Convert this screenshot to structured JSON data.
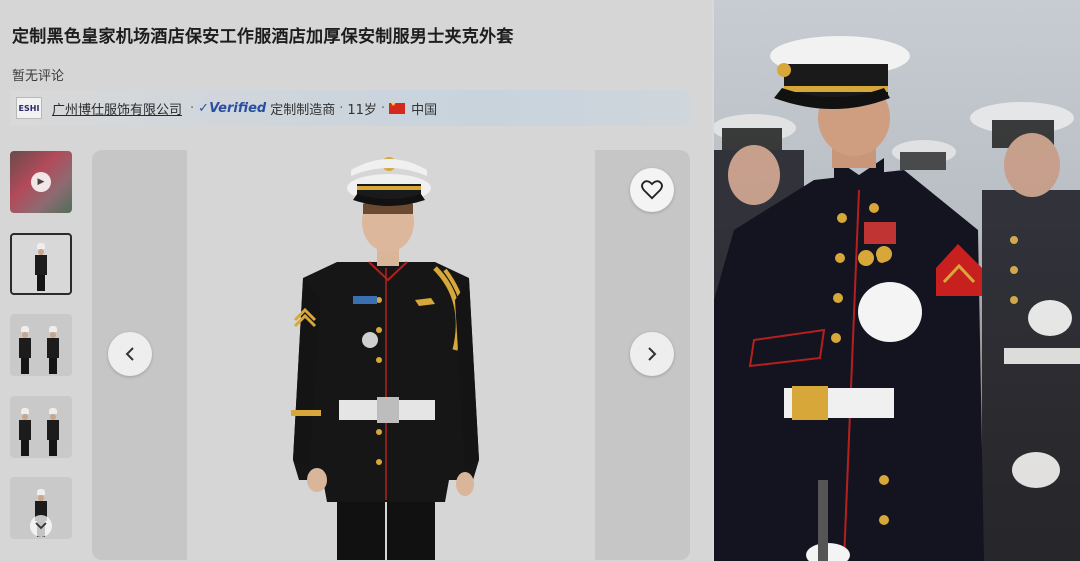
{
  "product": {
    "title": "定制黑色皇家机场酒店保安工作服酒店加厚保安制服男士夹克外套",
    "reviews": "暂无评论"
  },
  "supplier": {
    "logo_text": "ESHI",
    "company": "广州博仕服饰有限公司",
    "verified": "Verified",
    "type": "定制制造商",
    "years": "11岁",
    "country": "中国"
  },
  "thumbnails": [
    {
      "kind": "video",
      "icon": "play-icon"
    },
    {
      "kind": "image",
      "selected": true
    },
    {
      "kind": "image"
    },
    {
      "kind": "image"
    },
    {
      "kind": "image"
    }
  ],
  "icons": {
    "prev": "chevron-left-icon",
    "next": "chevron-right-icon",
    "favorite": "heart-icon",
    "thumb_scroll": "chevron-down-icon"
  },
  "colors": {
    "uniform_black": "#141414",
    "gold": "#d8a73a",
    "red_trim": "#b5201f",
    "cap_white": "#f0f0f0",
    "verified_blue": "#2a4ea0"
  }
}
